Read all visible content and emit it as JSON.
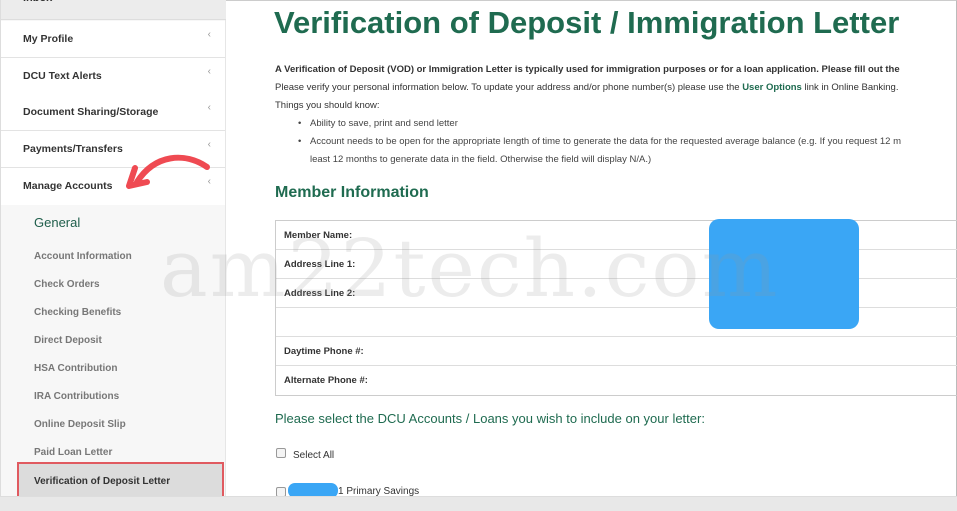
{
  "sidebar": {
    "inbox_label": "Inbox",
    "items": [
      {
        "label": "My Profile"
      },
      {
        "label": "DCU Text Alerts"
      },
      {
        "label": "Document Sharing/Storage"
      },
      {
        "label": "Payments/Transfers"
      },
      {
        "label": "Manage Accounts"
      }
    ],
    "chevron": "‹",
    "sub_heading": "General",
    "sub_items": [
      {
        "label": "Account Information"
      },
      {
        "label": "Check Orders"
      },
      {
        "label": "Checking Benefits"
      },
      {
        "label": "Direct Deposit"
      },
      {
        "label": "HSA Contribution"
      },
      {
        "label": "IRA Contributions"
      },
      {
        "label": "Online Deposit Slip"
      },
      {
        "label": "Paid Loan Letter"
      }
    ],
    "active_item": "Verification of Deposit Letter"
  },
  "main": {
    "title": "Verification of Deposit / Immigration Letter",
    "intro_bold": "A Verification of Deposit (VOD) or Immigration Letter is typically used for immigration purposes or for a loan application. Please fill out the",
    "intro_verify_prefix": "Please verify your personal information below. To update your address and/or phone number(s) please use the ",
    "intro_verify_link": "User Options",
    "intro_verify_suffix": " link in Online Banking.",
    "things_label": "Things you should know:",
    "bullets": [
      "Ability to save, print and send letter",
      "Account needs to be open for the appropriate length of time to generate the data for the requested average balance (e.g. If you request 12 m"
    ],
    "bullet_continuation": "least 12 months to generate data in the field. Otherwise the field will display N/A.)",
    "member_section_title": "Member Information",
    "member_fields": [
      {
        "label": "Member Name:"
      },
      {
        "label": "Address Line 1:"
      },
      {
        "label": "Address Line 2:"
      },
      {
        "label": ""
      },
      {
        "label": "Daytime Phone #:"
      },
      {
        "label": "Alternate Phone #:"
      }
    ],
    "select_title": "Please select the DCU Accounts / Loans you wish to include on your letter:",
    "select_all_label": "Select All",
    "account_label": "1 Primary Savings"
  },
  "watermark": "am22tech.com",
  "colors": {
    "accent_green": "#1f6b50",
    "redaction_blue": "#3aa6f5",
    "highlight_red": "#e05a60"
  }
}
